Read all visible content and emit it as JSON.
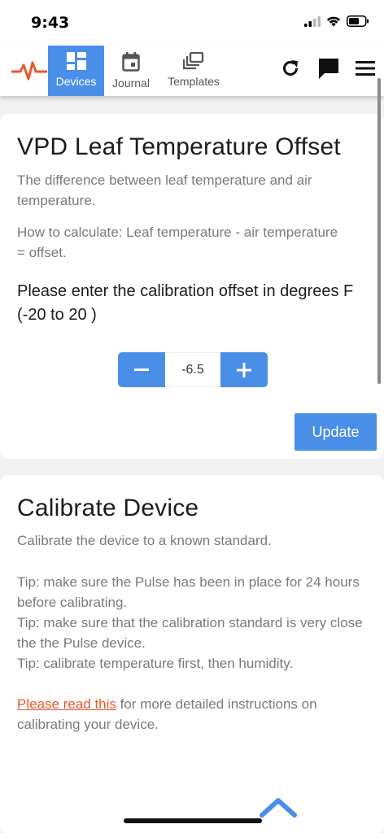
{
  "status": {
    "time": "9:43"
  },
  "nav": {
    "tabs": [
      {
        "label": "Devices",
        "icon": "dashboard-icon",
        "active": true
      },
      {
        "label": "Journal",
        "icon": "calendar-icon",
        "active": false
      },
      {
        "label": "Templates",
        "icon": "templates-icon",
        "active": false
      }
    ]
  },
  "vpd": {
    "title": "VPD Leaf Temperature Offset",
    "description": "The difference between leaf temperature and air temperature.",
    "how_to": "How to calculate: Leaf temperature - air temperature = offset.",
    "prompt": "Please enter the calibration offset in degrees F (-20 to 20 )",
    "value": "-6.5",
    "update_label": "Update"
  },
  "calibrate": {
    "title": "Calibrate Device",
    "description": "Calibrate the device to a known standard.",
    "tip1": "Tip: make sure the Pulse has been in place for 24 hours before calibrating.",
    "tip2": "Tip: make sure that the calibration standard is very close the the Pulse device.",
    "tip3": "Tip: calibrate temperature first, then humidity.",
    "link_text": "Please read this",
    "link_suffix": " for more detailed instructions on calibrating your device."
  },
  "colors": {
    "accent": "#4a8fe7",
    "brand": "#e8572a"
  }
}
